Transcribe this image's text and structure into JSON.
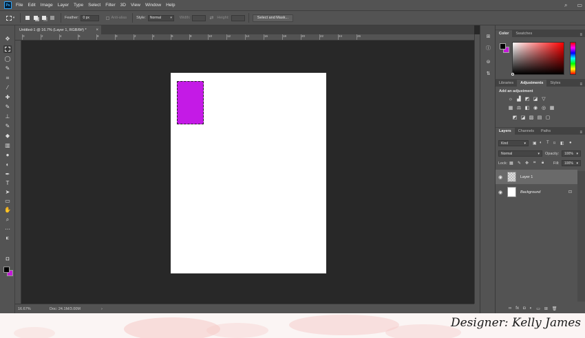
{
  "app": {
    "logo_text": "Ps"
  },
  "menu": [
    "File",
    "Edit",
    "Image",
    "Layer",
    "Type",
    "Select",
    "Filter",
    "3D",
    "View",
    "Window",
    "Help"
  ],
  "window_controls": {
    "search": "⌕",
    "arrange": "▭"
  },
  "options": {
    "feather_label": "Feather:",
    "feather_value": "0 px",
    "antialias_label": "Anti-alias",
    "style_label": "Style:",
    "style_value": "Normal",
    "width_label": "Width:",
    "height_label": "Height:",
    "select_mask_label": "Select and Mask..."
  },
  "document_tab": {
    "title": "Untitled-1 @ 16.7% (Layer 1, RGB/8#) *",
    "close": "×"
  },
  "ruler": [
    "0",
    "2",
    "4",
    "6",
    "8",
    "0",
    "2",
    "4",
    "6",
    "8",
    "10",
    "12",
    "14",
    "16",
    "18",
    "20",
    "22",
    "24",
    "26"
  ],
  "status": {
    "zoom": "16.67%",
    "doc": "Doc: 24.1M/3.00M",
    "arrow": "›"
  },
  "panels": {
    "color_tabs": [
      "Color",
      "Swatches"
    ],
    "adjust_tabs": [
      "Libraries",
      "Adjustments",
      "Styles"
    ],
    "add_adjustment": "Add an adjustment",
    "layers_tabs": [
      "Layers",
      "Channels",
      "Paths"
    ],
    "kind_label": "Kind",
    "blend_mode": "Normal",
    "opacity_label": "Opacity:",
    "opacity_value": "100%",
    "lock_label": "Lock:",
    "fill_label": "Fill:",
    "fill_value": "100%",
    "layers": [
      {
        "name": "Layer 1"
      },
      {
        "name": "Background"
      }
    ]
  },
  "colors": {
    "foreground": "#000000",
    "background": "#c41ad8",
    "shape_fill": "#c41ae6",
    "accent": "#31a8ff"
  },
  "banner": {
    "credit": "Designer: Kelly James"
  }
}
